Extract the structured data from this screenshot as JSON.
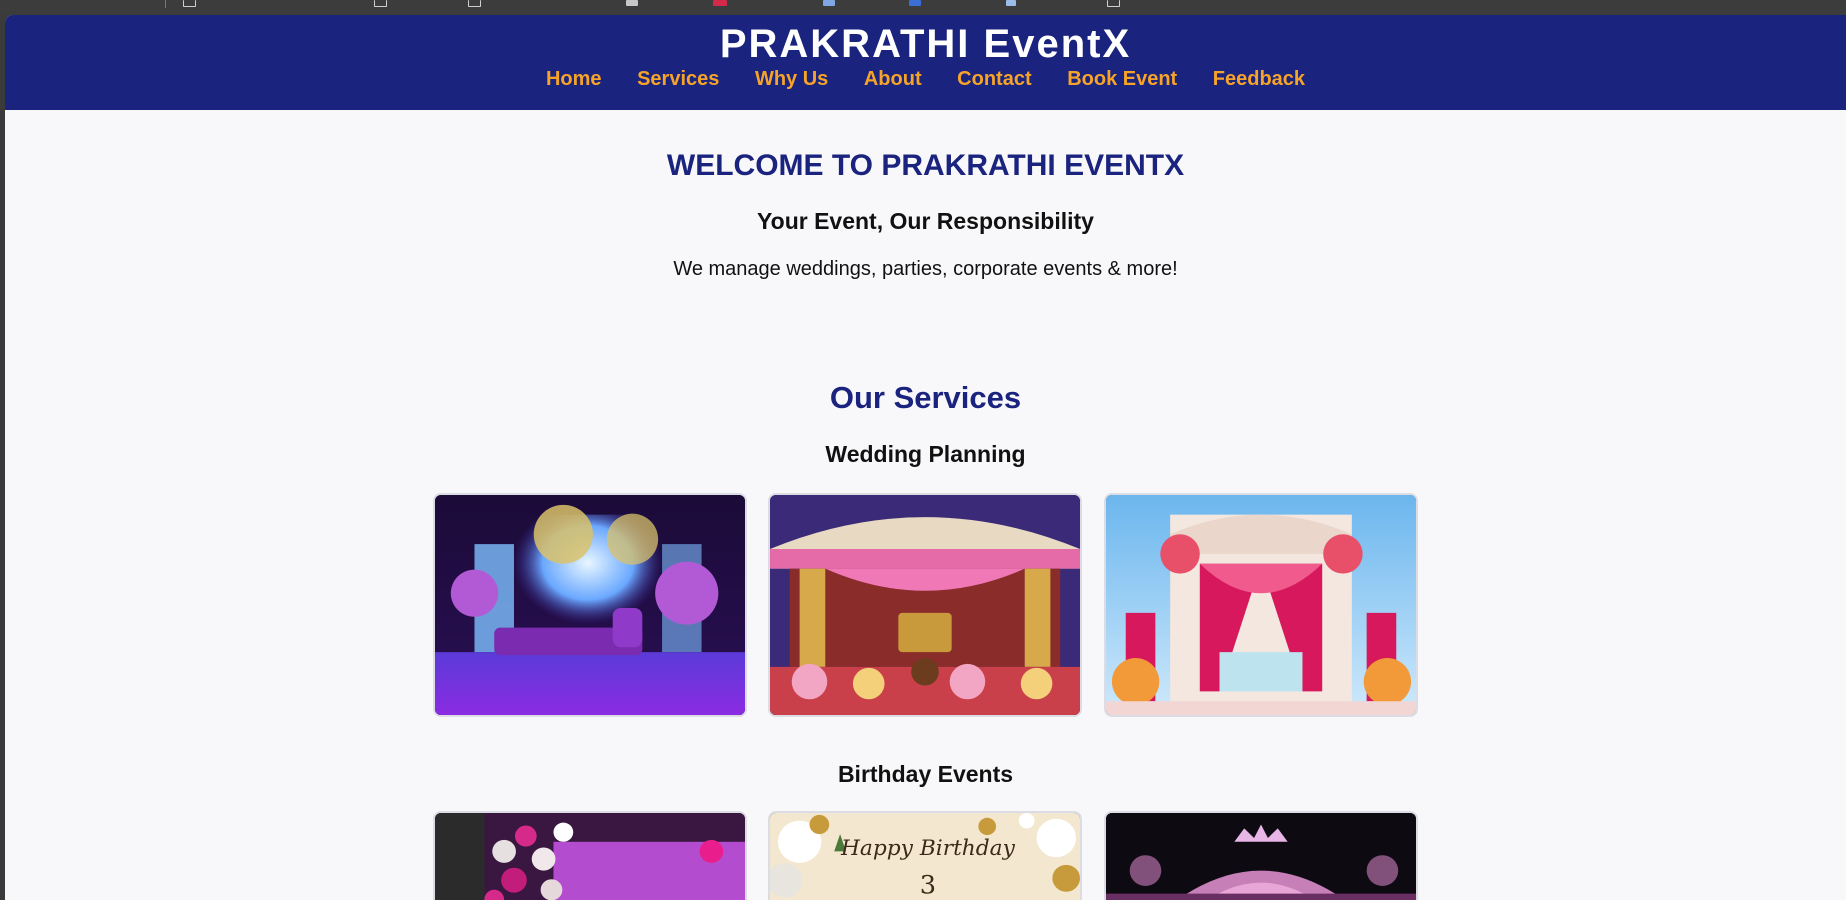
{
  "site": {
    "title": "PRAKRATHI EventX",
    "nav": [
      {
        "label": "Home"
      },
      {
        "label": "Services"
      },
      {
        "label": "Why Us"
      },
      {
        "label": "About"
      },
      {
        "label": "Contact"
      },
      {
        "label": "Book Event"
      },
      {
        "label": "Feedback"
      }
    ]
  },
  "hero": {
    "heading": "WELCOME TO PRAKRATHI EVENTX",
    "subheading": "Your Event, Our Responsibility",
    "text": "We manage weddings, parties, corporate events & more!"
  },
  "services": {
    "heading": "Our Services",
    "categories": [
      {
        "title": "Wedding Planning"
      },
      {
        "title": "Birthday Events",
        "banner_text": "Happy Birthday",
        "banner_number": "3"
      }
    ]
  },
  "colors": {
    "header_bg": "#1a237e",
    "nav_link": "#f6a32a",
    "heading": "#1a237e",
    "page_bg": "#f8f8fa"
  }
}
